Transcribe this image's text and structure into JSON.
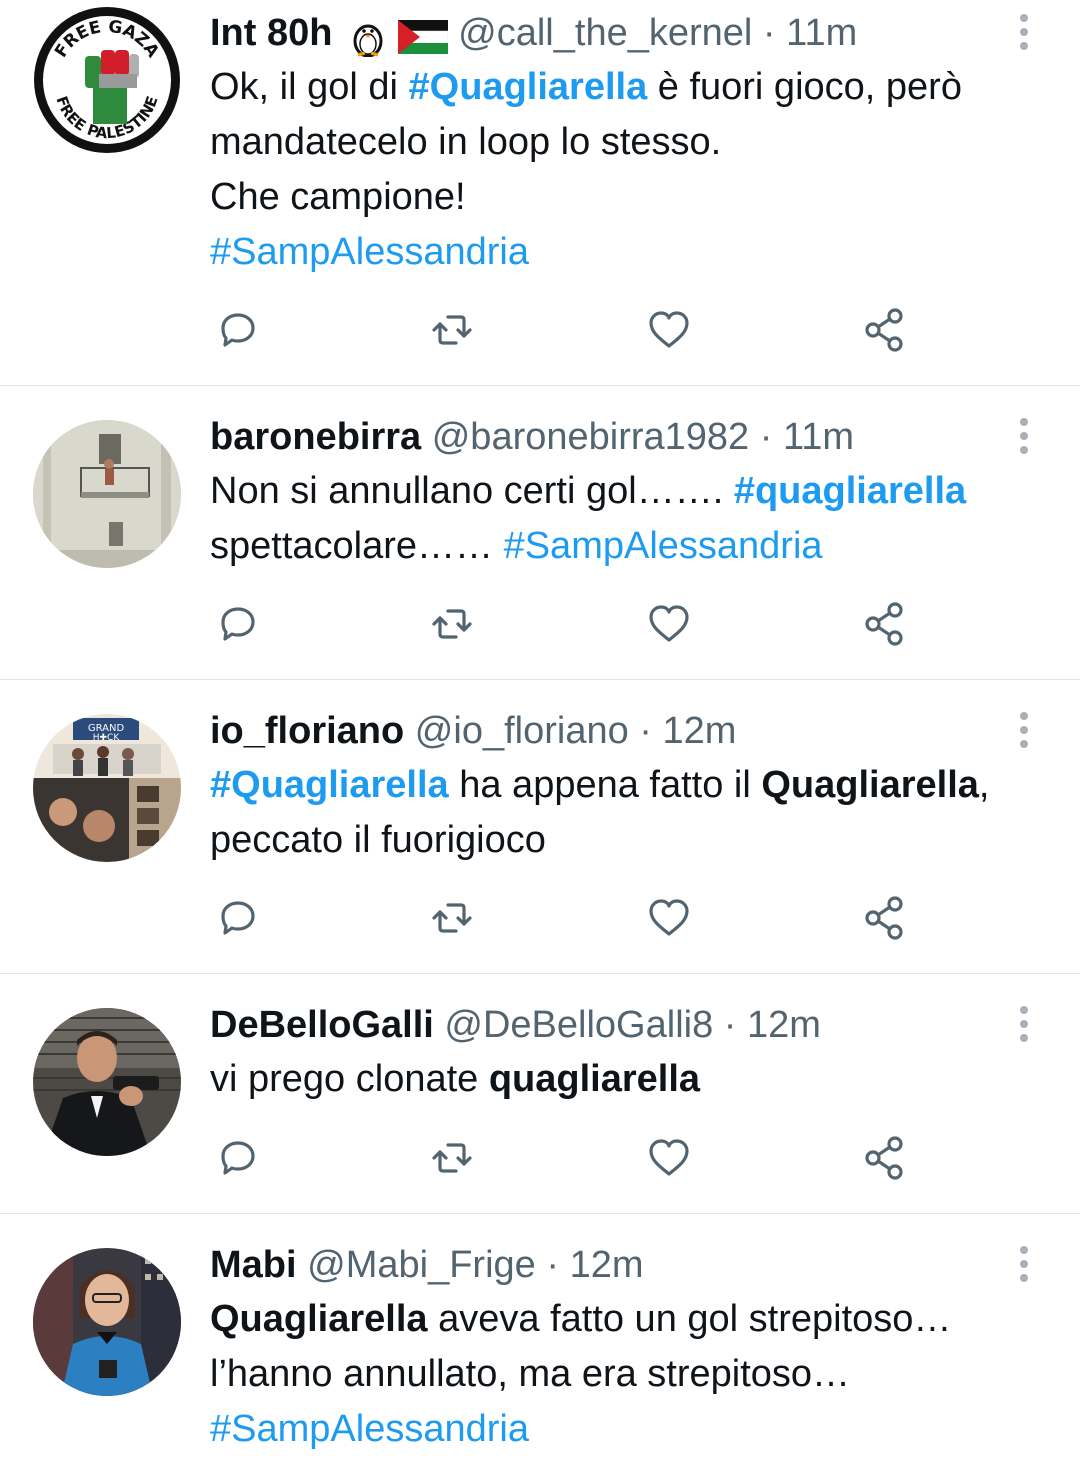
{
  "tweets": [
    {
      "name": "Int 80h",
      "handle": "@call_the_kernel",
      "separator": "·",
      "time": "11m",
      "avatar": "free-gaza-free-palestine-fist-logo",
      "avatar_text_top": "FREE GAZA",
      "avatar_text_bottom": "FREE PALESTINE",
      "name_badges": [
        "penguin-emoji",
        "palestine-flag-emoji"
      ],
      "lines": [
        [
          {
            "t": "Ok, il gol di "
          },
          {
            "t": "#Quagliarella",
            "style": "tag-bold"
          },
          {
            "t": " è fuori gioco, però"
          }
        ],
        [
          {
            "t": "mandatecelo in loop lo stesso."
          }
        ],
        [
          {
            "t": "Che campione!"
          }
        ],
        [
          {
            "t": "#SampAlessandria",
            "style": "tag"
          }
        ]
      ]
    },
    {
      "name": "baronebirra",
      "handle": "@baronebirra1982",
      "separator": "·",
      "time": "11m",
      "avatar": "balcony-photo",
      "lines": [
        [
          {
            "t": "Non si annullano certi gol……. "
          },
          {
            "t": "#quagliarella",
            "style": "tag-bold"
          }
        ],
        [
          {
            "t": "spettacolare…… "
          },
          {
            "t": "#SampAlessandria",
            "style": "tag"
          }
        ]
      ]
    },
    {
      "name": "io_floriano",
      "handle": "@io_floriano",
      "separator": "·",
      "time": "12m",
      "avatar": "grand-hack-collage-photo",
      "avatar_text": "GRAND H✚CK",
      "lines": [
        [
          {
            "t": "#Quagliarella",
            "style": "tag-bold"
          },
          {
            "t": " ha appena fatto il "
          },
          {
            "t": "Quagliarella",
            "style": "bold"
          },
          {
            "t": ","
          }
        ],
        [
          {
            "t": "peccato il fuorigioco"
          }
        ]
      ]
    },
    {
      "name": "DeBelloGalli",
      "handle": "@DeBelloGalli8",
      "separator": "·",
      "time": "12m",
      "avatar": "man-in-suit-pointing-gun-photo",
      "lines": [
        [
          {
            "t": "vi prego clonate "
          },
          {
            "t": "quagliarella",
            "style": "bold"
          }
        ]
      ]
    },
    {
      "name": "Mabi",
      "handle": "@Mabi_Frige",
      "separator": "·",
      "time": "12m",
      "avatar": "woman-in-blue-uniform-photo",
      "lines": [
        [
          {
            "t": "Quagliarella",
            "style": "bold"
          },
          {
            "t": " aveva fatto un gol strepitoso…"
          }
        ],
        [
          {
            "t": "l’hanno annullato, ma era strepitoso…"
          }
        ],
        [
          {
            "t": "#SampAlessandria",
            "style": "tag"
          }
        ]
      ]
    }
  ],
  "actions": [
    "reply-icon",
    "retweet-icon",
    "like-icon",
    "share-icon"
  ],
  "colors": {
    "text": "#0f1419",
    "secondary": "#536471",
    "hashtag": "#1d9bf0",
    "divider": "#e3e6e8",
    "icon": "#536471"
  }
}
